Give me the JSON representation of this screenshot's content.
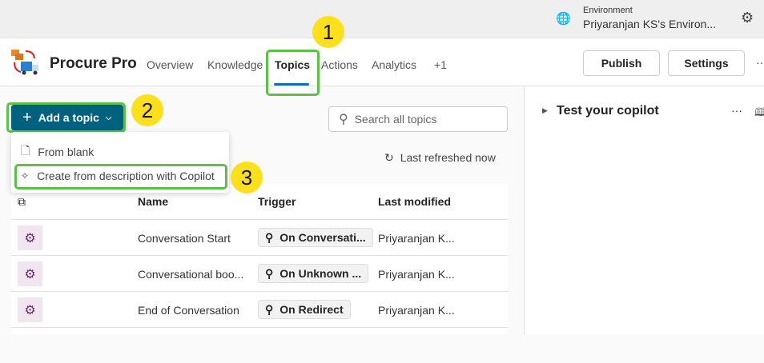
{
  "topbar": {
    "env_label": "Environment",
    "env_value": "Priyaranjan KS's Environ..."
  },
  "header": {
    "app_name": "Procure Pro",
    "tabs": [
      {
        "label": "Overview"
      },
      {
        "label": "Knowledge"
      },
      {
        "label": "Topics",
        "active": true
      },
      {
        "label": "Actions"
      },
      {
        "label": "Analytics"
      },
      {
        "label": "+1"
      }
    ],
    "publish": "Publish",
    "settings": "Settings",
    "more": "···"
  },
  "toolbar": {
    "add_topic": "Add a topic",
    "search_placeholder": "Search all topics",
    "last_refreshed": "Last refreshed now"
  },
  "menu": {
    "items": [
      {
        "label": "From blank",
        "icon": "document-icon"
      },
      {
        "label": "Create from description with Copilot",
        "icon": "sparkle-icon"
      }
    ]
  },
  "table": {
    "headers": {
      "name": "Name",
      "trigger": "Trigger",
      "modified": "Last modified"
    },
    "rows": [
      {
        "name": "Conversation Start",
        "trigger": "On Conversati...",
        "modified": "Priyaranjan K..."
      },
      {
        "name": "Conversational boo...",
        "trigger": "On Unknown ...",
        "modified": "Priyaranjan K..."
      },
      {
        "name": "End of Conversation",
        "trigger": "On Redirect",
        "modified": "Priyaranjan K..."
      }
    ]
  },
  "test_panel": {
    "title": "Test your copilot",
    "more": "···"
  },
  "annotations": {
    "one": "1",
    "two": "2",
    "three": "3",
    "highlight_color": "#5cc145",
    "badge_color": "#fde01c"
  },
  "colors": {
    "primary": "#036180",
    "tab_accent": "#0f6cbd"
  }
}
